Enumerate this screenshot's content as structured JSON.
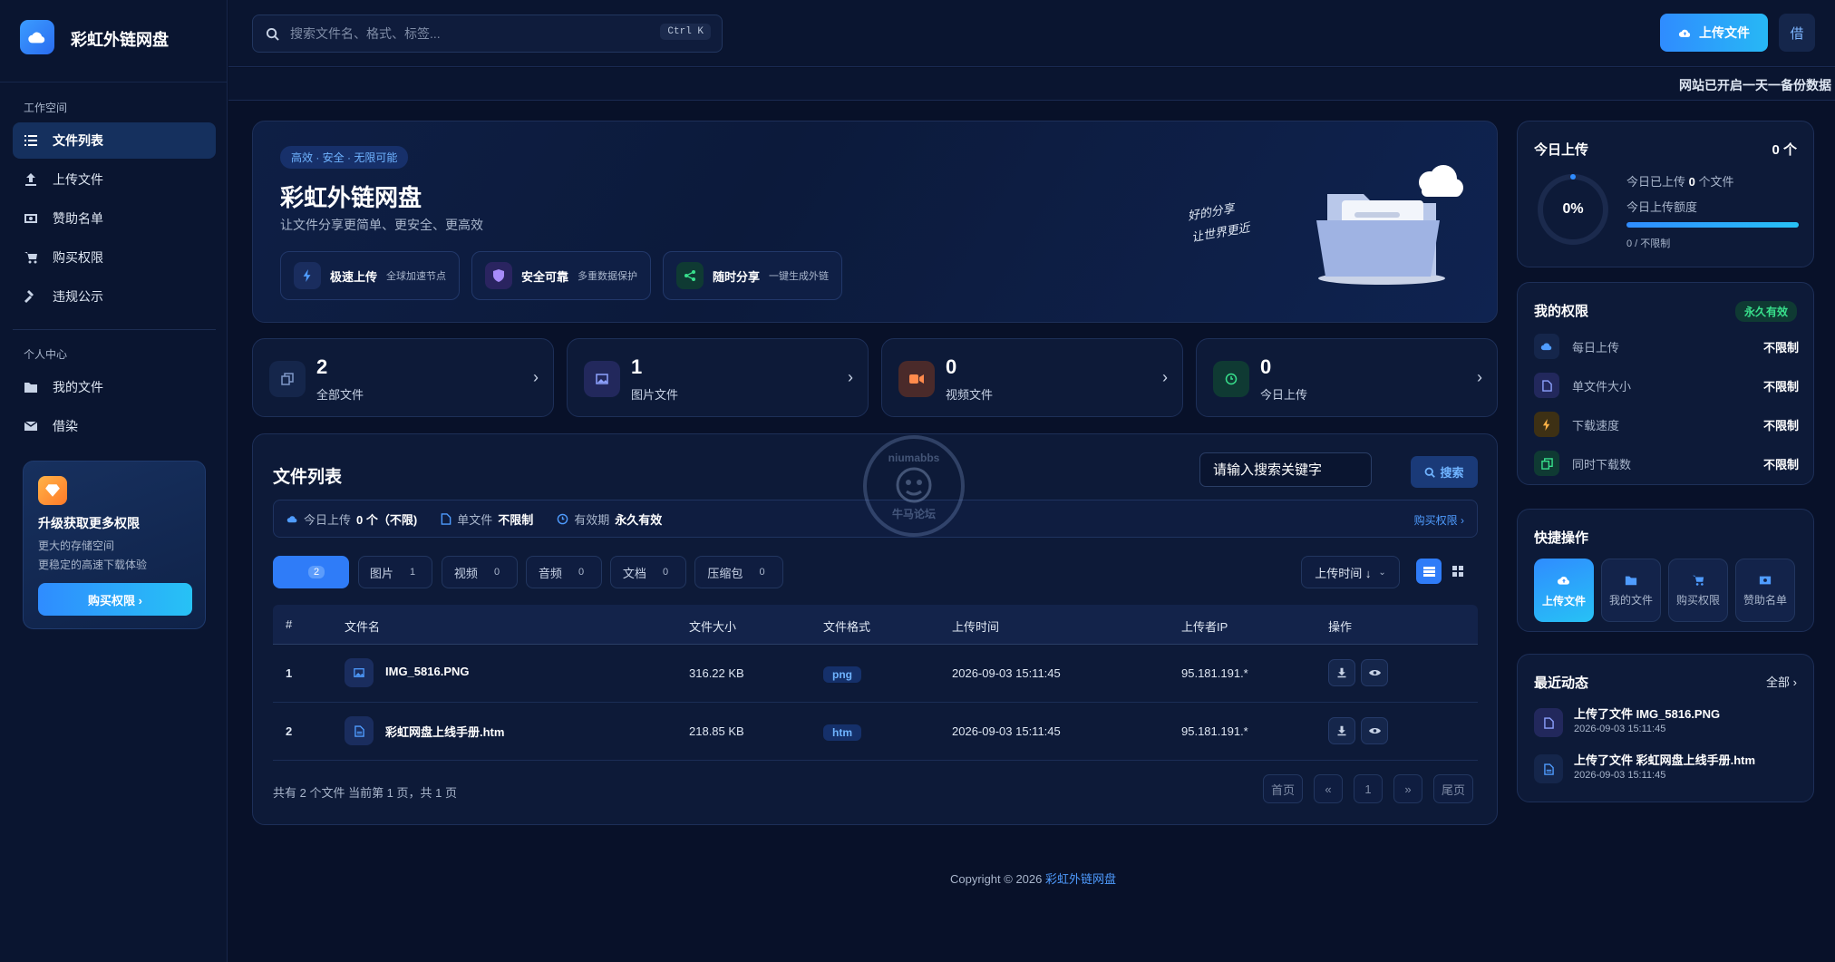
{
  "brand": {
    "name": "彩虹外链网盘"
  },
  "sidebar": {
    "section1": "工作空间",
    "items1": [
      {
        "label": "文件列表",
        "icon": "list-icon"
      },
      {
        "label": "上传文件",
        "icon": "upload-icon"
      },
      {
        "label": "赞助名单",
        "icon": "money-icon"
      },
      {
        "label": "购买权限",
        "icon": "cart-icon"
      },
      {
        "label": "违规公示",
        "icon": "gavel-icon"
      }
    ],
    "section2": "个人中心",
    "items2": [
      {
        "label": "我的文件",
        "icon": "folder-icon"
      },
      {
        "label": "借染",
        "icon": "mail-icon"
      }
    ],
    "upgrade": {
      "title": "升级获取更多权限",
      "line1": "更大的存储空间",
      "line2": "更稳定的高速下载体验",
      "button": "购买权限 ›"
    }
  },
  "header": {
    "search_placeholder": "搜索文件名、格式、标签...",
    "shortcut": "Ctrl K",
    "upload_label": "上传文件",
    "icon_btn_label": "借"
  },
  "marquee": "网站已开启一天一备份数据",
  "hero": {
    "tag": "高效 · 安全 · 无限可能",
    "title": "彩虹外链网盘",
    "subtitle": "让文件分享更简单、更安全、更高效",
    "features": [
      {
        "title": "极速上传",
        "desc": "全球加速节点"
      },
      {
        "title": "安全可靠",
        "desc": "多重数据保护"
      },
      {
        "title": "随时分享",
        "desc": "一键生成外链"
      }
    ],
    "slogan1": "好的分享",
    "slogan2": "让世界更近"
  },
  "stats": [
    {
      "value": "2",
      "label": "全部文件"
    },
    {
      "value": "1",
      "label": "图片文件"
    },
    {
      "value": "0",
      "label": "视频文件"
    },
    {
      "value": "0",
      "label": "今日上传"
    }
  ],
  "filelist": {
    "title": "文件列表",
    "search_placeholder": "请输入搜索关键字",
    "search_button": "搜索",
    "quota": {
      "today_label": "今日上传",
      "today_value": "0 个（不限)",
      "single_label": "单文件",
      "single_value": "不限制",
      "valid_label": "有效期",
      "valid_value": "永久有效",
      "link": "购买权限 ›"
    },
    "tabs": [
      {
        "label": "",
        "count": "2"
      },
      {
        "label": "图片",
        "count": "1"
      },
      {
        "label": "视频",
        "count": "0"
      },
      {
        "label": "音频",
        "count": "0"
      },
      {
        "label": "文档",
        "count": "0"
      },
      {
        "label": "压缩包",
        "count": "0"
      }
    ],
    "sort": "上传时间 ↓",
    "columns": [
      "#",
      "文件名",
      "文件大小",
      "文件格式",
      "上传时间",
      "上传者IP",
      "操作"
    ],
    "rows": [
      {
        "no": "1",
        "name": "IMG_5816.PNG",
        "size": "316.22 KB",
        "format": "png",
        "time": "2026-09-03 15:11:45",
        "ip": "95.181.191.*"
      },
      {
        "no": "2",
        "name": "彩虹网盘上线手册.htm",
        "size": "218.85 KB",
        "format": "htm",
        "time": "2026-09-03 15:11:45",
        "ip": "95.181.191.*"
      }
    ],
    "footer": "共有 2 个文件  当前第 1 页，共 1 页",
    "pagination": {
      "first": "首页",
      "prev": "«",
      "page": "1",
      "next": "»",
      "last": "尾页"
    }
  },
  "copyright": {
    "prefix": "Copyright © 2026 ",
    "link": "彩虹外链网盘"
  },
  "today": {
    "title": "今日上传",
    "count": "0 个",
    "percent_text": "0%",
    "progress": 0,
    "line1_prefix": "今日已上传 ",
    "line1_value": "0",
    "line1_suffix": " 个文件",
    "line2": "今日上传额度",
    "line3": "0 / 不限制"
  },
  "permissions": {
    "title": "我的权限",
    "badge": "永久有效",
    "rows": [
      {
        "label": "每日上传",
        "value": "不限制"
      },
      {
        "label": "单文件大小",
        "value": "不限制"
      },
      {
        "label": "下载速度",
        "value": "不限制"
      },
      {
        "label": "同时下载数",
        "value": "不限制"
      }
    ]
  },
  "quick": {
    "title": "快捷操作",
    "items": [
      {
        "label": "上传文件"
      },
      {
        "label": "我的文件"
      },
      {
        "label": "购买权限"
      },
      {
        "label": "赞助名单"
      }
    ]
  },
  "recent": {
    "title": "最近动态",
    "all": "全部 ›",
    "items": [
      {
        "text": "上传了文件 IMG_5816.PNG",
        "date": "2026-09-03 15:11:45"
      },
      {
        "text": "上传了文件 彩虹网盘上线手册.htm",
        "date": "2026-09-03 15:11:45"
      }
    ]
  },
  "watermark": {
    "top": "niumabbs",
    "bottom": "牛马论坛"
  },
  "colors": {
    "accent": "#2f8cff",
    "background": "#081129",
    "panel": "#0d1a38",
    "success": "#38e08c"
  }
}
